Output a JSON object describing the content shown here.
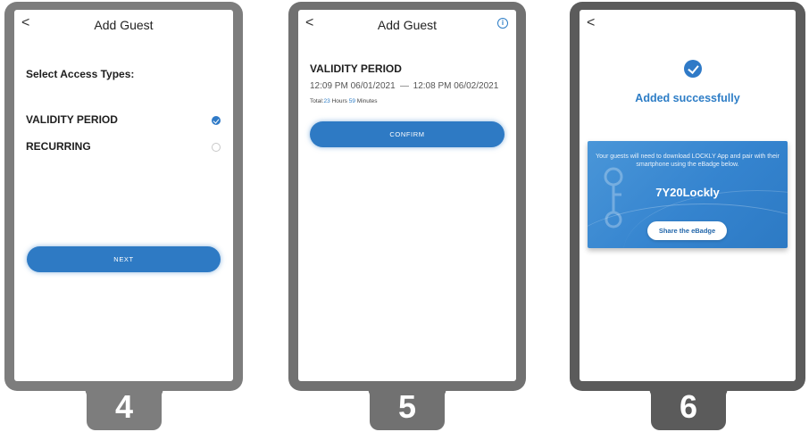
{
  "screen4": {
    "back": "<",
    "title": "Add Guest",
    "prompt": "Select Access Types:",
    "options": [
      {
        "label": "VALIDITY PERIOD",
        "selected": true
      },
      {
        "label": "RECURRING",
        "selected": false
      }
    ],
    "next_label": "NEXT",
    "step": "4"
  },
  "screen5": {
    "back": "<",
    "title": "Add Guest",
    "heading": "VALIDITY PERIOD",
    "start": "12:09 PM 06/01/2021",
    "end": "12:08 PM 06/02/2021",
    "total_prefix": "Total:",
    "hours": "23",
    "hours_unit": " Hours ",
    "minutes": "59",
    "minutes_unit": " Minutes",
    "confirm_label": "CONFIRM",
    "step": "5"
  },
  "screen6": {
    "back": "<",
    "success": "Added successfully",
    "description": "Your guests will need to download LOCKLY App and pair with their smartphone using the eBadge below.",
    "code": "7Y20Lockly",
    "share_label": "Share the eBadge",
    "step": "6"
  },
  "colors": {
    "accent": "#2e7ac4",
    "frame4": "#7d7d7d",
    "frame5": "#717171",
    "frame6": "#5b5b5b"
  }
}
